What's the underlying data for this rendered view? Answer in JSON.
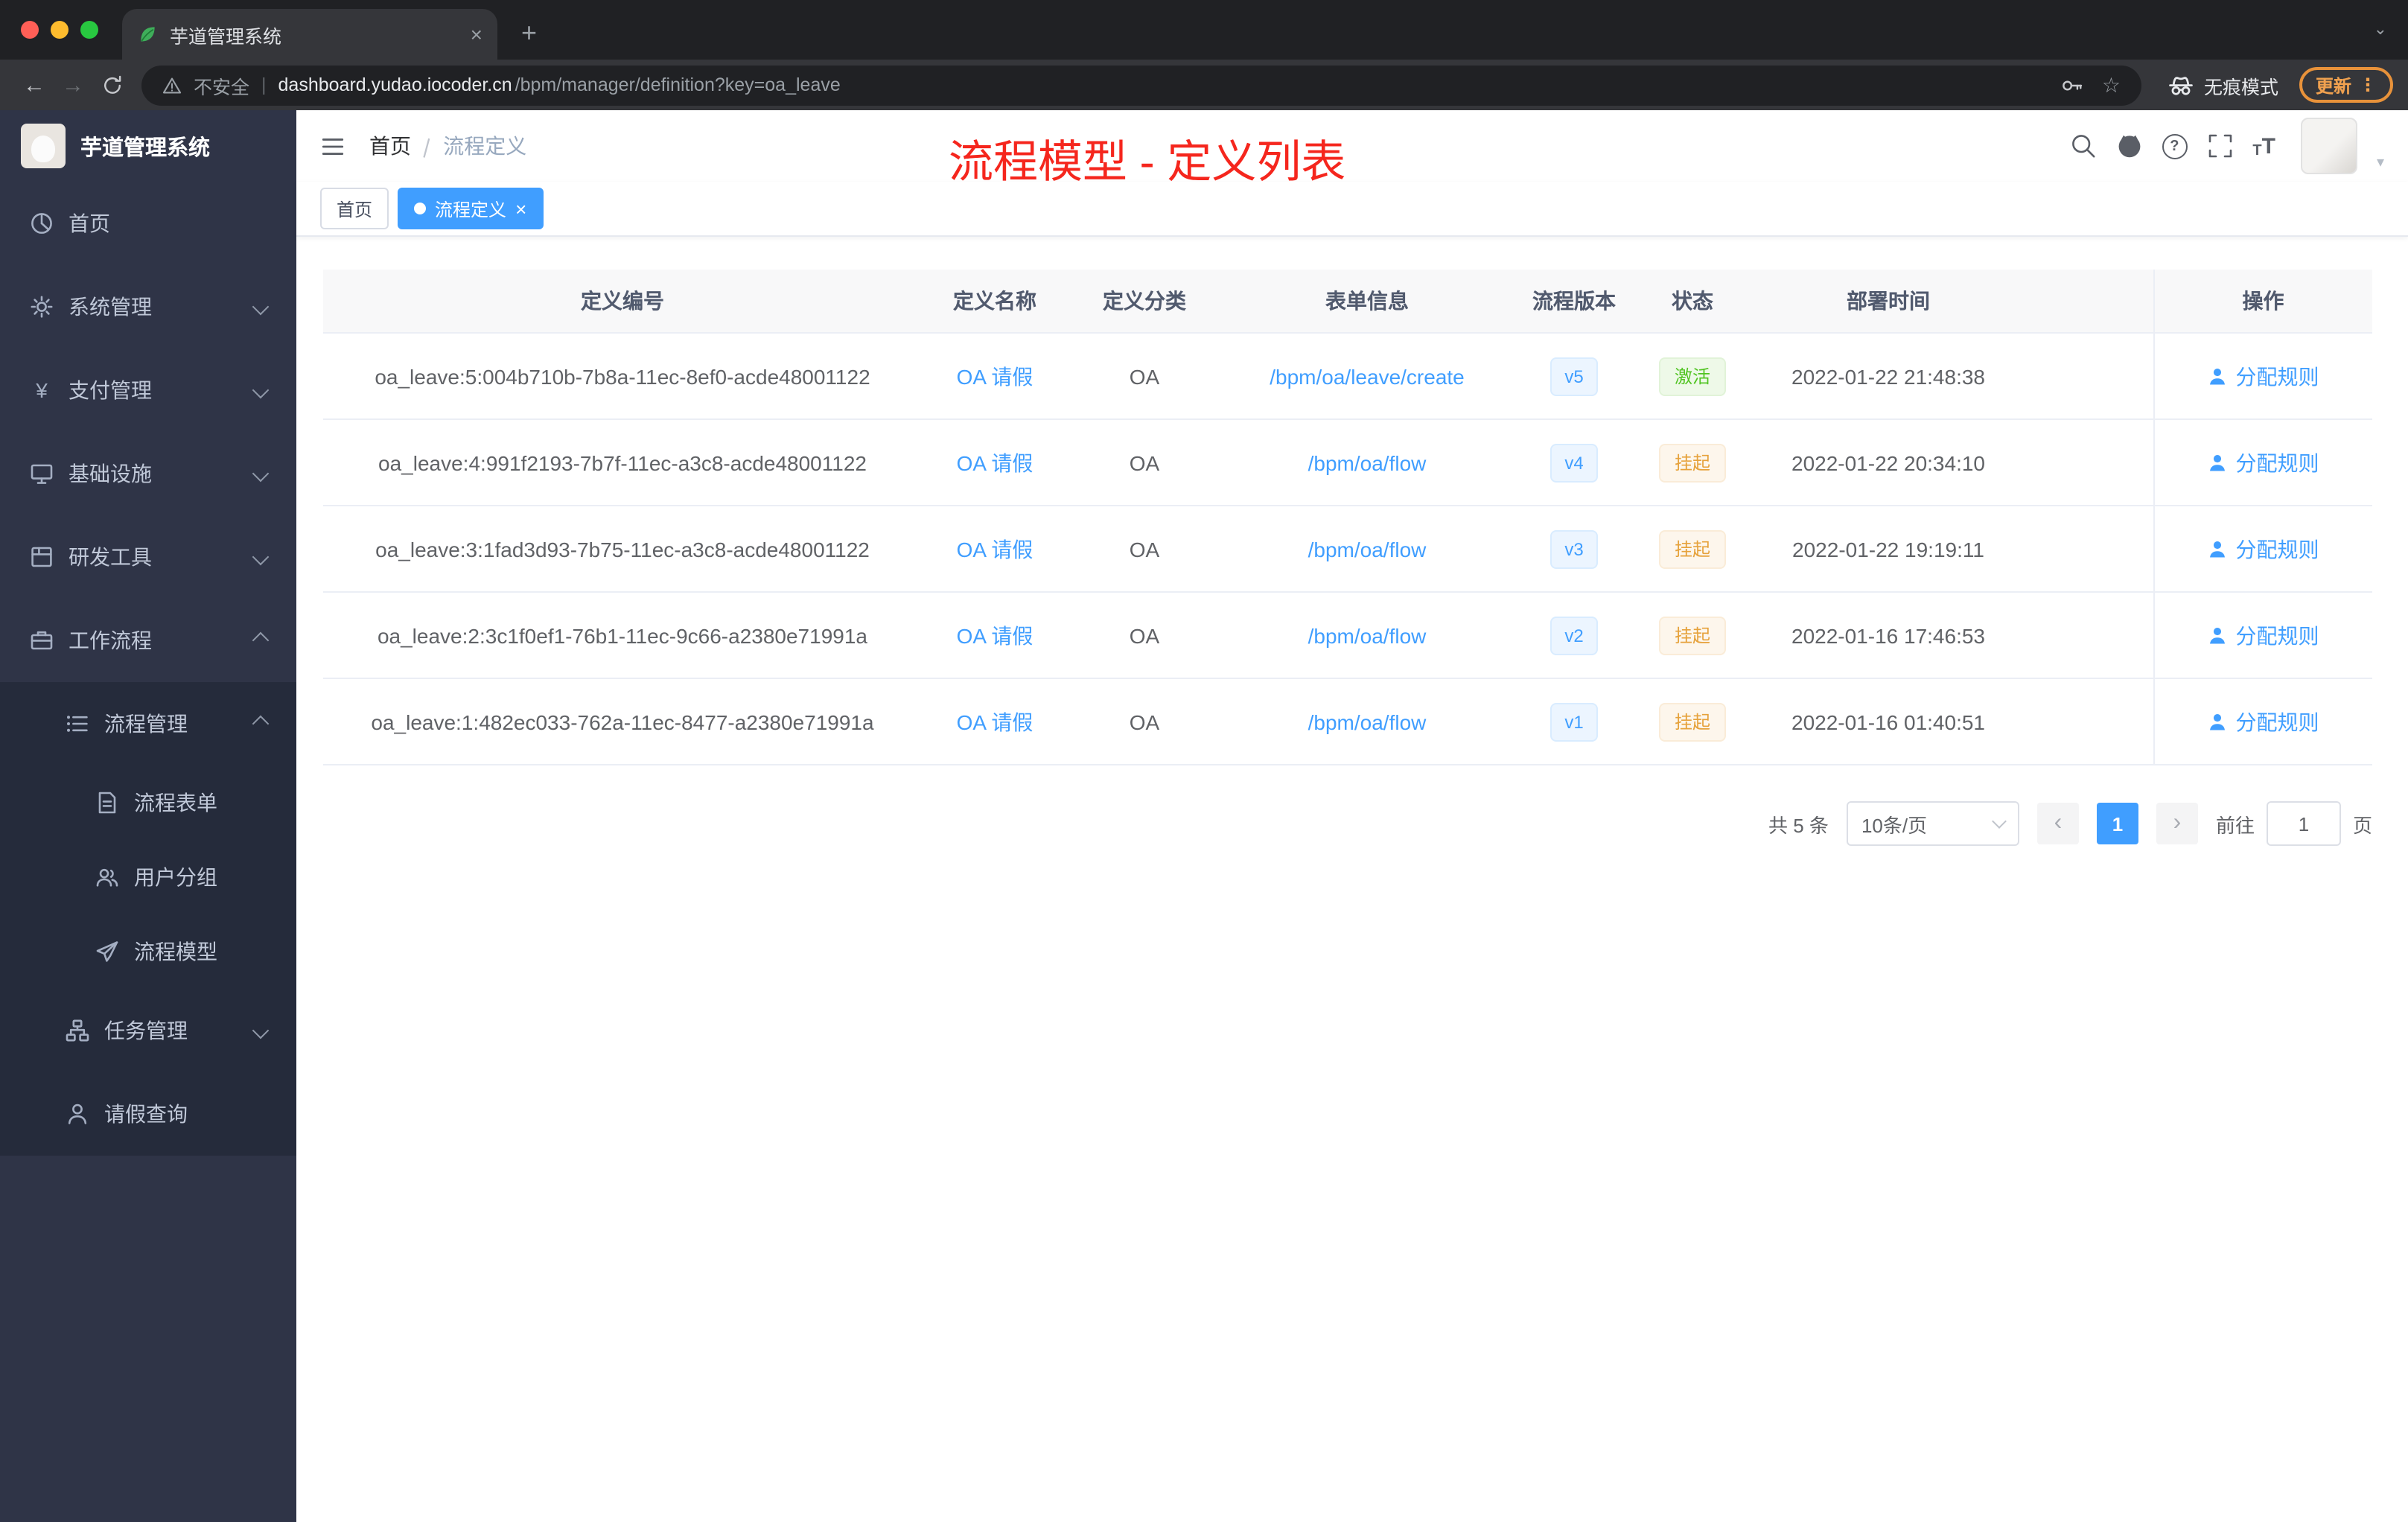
{
  "glyphs": {
    "back": "←",
    "forward": "→",
    "newtab": "+",
    "close": "×",
    "star": "☆",
    "dots": "⋮",
    "divider": "|",
    "dot": "●",
    "prev": "‹",
    "next": "›",
    "caret": "▾",
    "tab_caret": "⌄",
    "t_small": "T",
    "t_big": "T",
    "question": "?"
  },
  "browser": {
    "tab_title": "芋道管理系统",
    "warning_label": "不安全",
    "url_host": "dashboard.yudao.iocoder.cn",
    "url_path": "/bpm/manager/definition?key=oa_leave",
    "incognito_label": "无痕模式",
    "update_label": "更新"
  },
  "sidebar": {
    "logo_title": "芋道管理系统",
    "items": [
      {
        "label": "首页"
      },
      {
        "label": "系统管理"
      },
      {
        "label": "支付管理"
      },
      {
        "label": "基础设施"
      },
      {
        "label": "研发工具"
      },
      {
        "label": "工作流程"
      },
      {
        "label": "流程管理"
      },
      {
        "label": "流程表单"
      },
      {
        "label": "用户分组"
      },
      {
        "label": "流程模型"
      },
      {
        "label": "任务管理"
      },
      {
        "label": "请假查询"
      }
    ]
  },
  "header": {
    "breadcrumb_home": "首页",
    "breadcrumb_current": "流程定义",
    "annotation": "流程模型 - 定义列表"
  },
  "tags": {
    "home": "首页",
    "active": "流程定义"
  },
  "table": {
    "columns": [
      "定义编号",
      "定义名称",
      "定义分类",
      "表单信息",
      "流程版本",
      "状态",
      "部署时间",
      "操作"
    ],
    "rows": [
      {
        "id": "oa_leave:5:004b710b-7b8a-11ec-8ef0-acde48001122",
        "name": "OA 请假",
        "category": "OA",
        "form": "/bpm/oa/leave/create",
        "version": "v5",
        "status": "激活",
        "time": "2022-01-22 21:48:38",
        "action": "分配规则"
      },
      {
        "id": "oa_leave:4:991f2193-7b7f-11ec-a3c8-acde48001122",
        "name": "OA 请假",
        "category": "OA",
        "form": "/bpm/oa/flow",
        "version": "v4",
        "status": "挂起",
        "time": "2022-01-22 20:34:10",
        "action": "分配规则"
      },
      {
        "id": "oa_leave:3:1fad3d93-7b75-11ec-a3c8-acde48001122",
        "name": "OA 请假",
        "category": "OA",
        "form": "/bpm/oa/flow",
        "version": "v3",
        "status": "挂起",
        "time": "2022-01-22 19:19:11",
        "action": "分配规则"
      },
      {
        "id": "oa_leave:2:3c1f0ef1-76b1-11ec-9c66-a2380e71991a",
        "name": "OA 请假",
        "category": "OA",
        "form": "/bpm/oa/flow",
        "version": "v2",
        "status": "挂起",
        "time": "2022-01-16 17:46:53",
        "action": "分配规则"
      },
      {
        "id": "oa_leave:1:482ec033-762a-11ec-8477-a2380e71991a",
        "name": "OA 请假",
        "category": "OA",
        "form": "/bpm/oa/flow",
        "version": "v1",
        "status": "挂起",
        "time": "2022-01-16 01:40:51",
        "action": "分配规则"
      }
    ]
  },
  "pagination": {
    "total": "共 5 条",
    "page_size": "10条/页",
    "page": "1",
    "goto_label": "前往",
    "goto_value": "1",
    "page_unit": "页"
  },
  "colors": {
    "accent": "#409eff",
    "success": "#67c23a",
    "warning": "#e6a23c",
    "annotation": "#f5261d",
    "sidebar_bg": "#2f3447"
  }
}
